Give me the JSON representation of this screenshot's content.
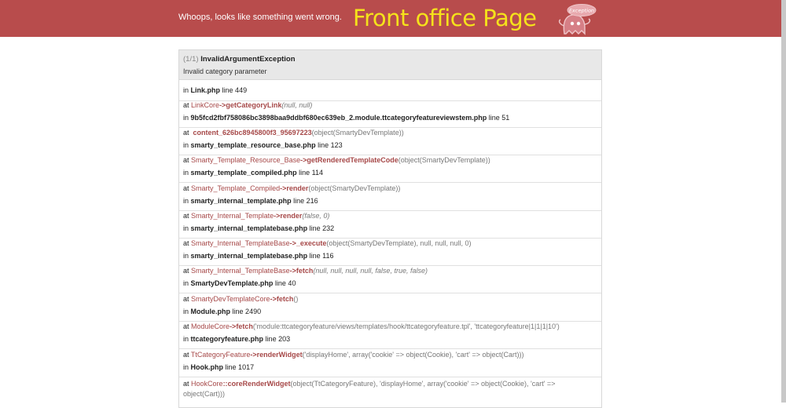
{
  "header": {
    "message": "Whoops, looks like something went wrong.",
    "front_title": "Front office Page",
    "mascot_text": "Exception"
  },
  "exception": {
    "count": "(1/1)",
    "name": "InvalidArgumentException",
    "message": "Invalid category parameter"
  },
  "trace": [
    {
      "in": "in",
      "file": "Link.php",
      "line": "line 449"
    },
    {
      "at": "at",
      "cls": "LinkCore",
      "sep": "->",
      "fn": "getCategoryLink",
      "args": "(null, null)",
      "in": "in",
      "file": "9b5fcd2fbf758086bc3898baa9ddbf680ec639eb_2.module.ttcategoryfeatureviewstem.php",
      "line": "line 51"
    },
    {
      "at": "at",
      "fn": "content_626bc8945800f3_95697223",
      "args": "(object(SmartyDevTemplate))",
      "in": "in",
      "file": "smarty_template_resource_base.php",
      "line": "line 123"
    },
    {
      "at": "at",
      "cls": "Smarty_Template_Resource_Base",
      "sep": "->",
      "fn": "getRenderedTemplateCode",
      "args": "(object(SmartyDevTemplate))",
      "in": "in",
      "file": "smarty_template_compiled.php",
      "line": "line 114"
    },
    {
      "at": "at",
      "cls": "Smarty_Template_Compiled",
      "sep": "->",
      "fn": "render",
      "args": "(object(SmartyDevTemplate))",
      "in": "in",
      "file": "smarty_internal_template.php",
      "line": "line 216"
    },
    {
      "at": "at",
      "cls": "Smarty_Internal_Template",
      "sep": "->",
      "fn": "render",
      "args": "(false, 0)",
      "in": "in",
      "file": "smarty_internal_templatebase.php",
      "line": "line 232"
    },
    {
      "at": "at",
      "cls": "Smarty_Internal_TemplateBase",
      "sep": "->",
      "fn": "_execute",
      "args": "(object(SmartyDevTemplate), null, null, null, 0)",
      "in": "in",
      "file": "smarty_internal_templatebase.php",
      "line": "line 116"
    },
    {
      "at": "at",
      "cls": "Smarty_Internal_TemplateBase",
      "sep": "->",
      "fn": "fetch",
      "args": "(null, null, null, null, false, true, false)",
      "in": "in",
      "file": "SmartyDevTemplate.php",
      "line": "line 40"
    },
    {
      "at": "at",
      "cls": "SmartyDevTemplateCore",
      "sep": "->",
      "fn": "fetch",
      "args": "()",
      "in": "in",
      "file": "Module.php",
      "line": "line 2490"
    },
    {
      "at": "at",
      "cls": "ModuleCore",
      "sep": "->",
      "fn": "fetch",
      "args": "('module:ttcategoryfeature/views/templates/hook/ttcategoryfeature.tpl', 'ttcategoryfeature|1|1|1|10')",
      "in": "in",
      "file": "ttcategoryfeature.php",
      "line": "line 203"
    },
    {
      "at": "at",
      "cls": "TtCategoryFeature",
      "sep": "->",
      "fn": "renderWidget",
      "args": "('displayHome', array('cookie' => object(Cookie), 'cart' => object(Cart)))",
      "in": "in",
      "file": "Hook.php",
      "line": "line 1017"
    },
    {
      "at": "at",
      "cls": "HookCore",
      "sep": "::",
      "fn": "coreRenderWidget",
      "args": "(object(TtCategoryFeature), 'displayHome', array('cookie' => object(Cookie), 'cart' =>",
      "args2": "object(Cart)))"
    }
  ]
}
